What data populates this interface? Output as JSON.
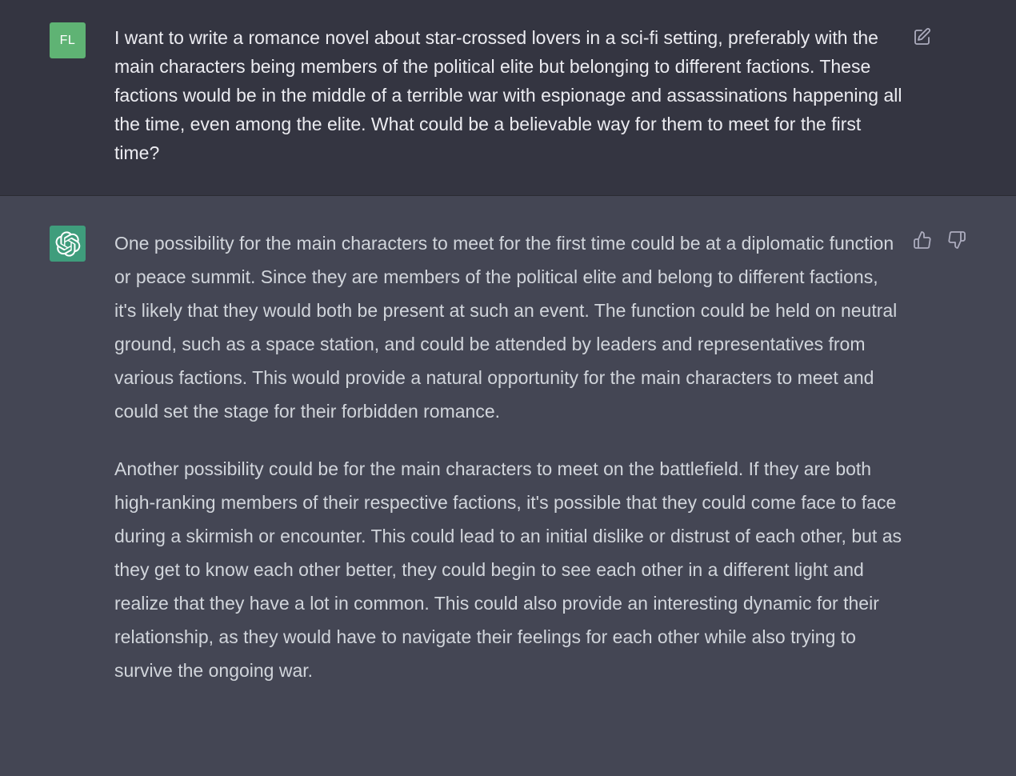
{
  "user_message": {
    "avatar_initials": "FL",
    "avatar_color": "#5fb374",
    "text": "I want to write a romance novel about star-crossed lovers in a sci-fi setting, preferably with the main characters being members of the political elite but belonging to different factions. These factions would be in the middle of a terrible war with espionage and assassinations happening all the time, even among the elite. What could be a believable way for them to meet for the first time?",
    "edit_icon": "edit-icon"
  },
  "assistant_message": {
    "avatar_icon": "openai-logo-icon",
    "avatar_color": "#3f9d7c",
    "paragraphs": [
      "One possibility for the main characters to meet for the first time could be at a diplomatic function or peace summit. Since they are members of the political elite and belong to different factions, it's likely that they would both be present at such an event. The function could be held on neutral ground, such as a space station, and could be attended by leaders and representatives from various factions. This would provide a natural opportunity for the main characters to meet and could set the stage for their forbidden romance.",
      "Another possibility could be for the main characters to meet on the battlefield. If they are both high-ranking members of their respective factions, it's possible that they could come face to face during a skirmish or encounter. This could lead to an initial dislike or distrust of each other, but as they get to know each other better, they could begin to see each other in a different light and realize that they have a lot in common. This could also provide an interesting dynamic for their relationship, as they would have to navigate their feelings for each other while also trying to survive the ongoing war."
    ],
    "feedback_icons": [
      "thumbs-up-icon",
      "thumbs-down-icon"
    ]
  },
  "colors": {
    "user_bg": "#343541",
    "assistant_bg": "#444654",
    "text": "#ececf1",
    "icon": "#acacbe"
  }
}
